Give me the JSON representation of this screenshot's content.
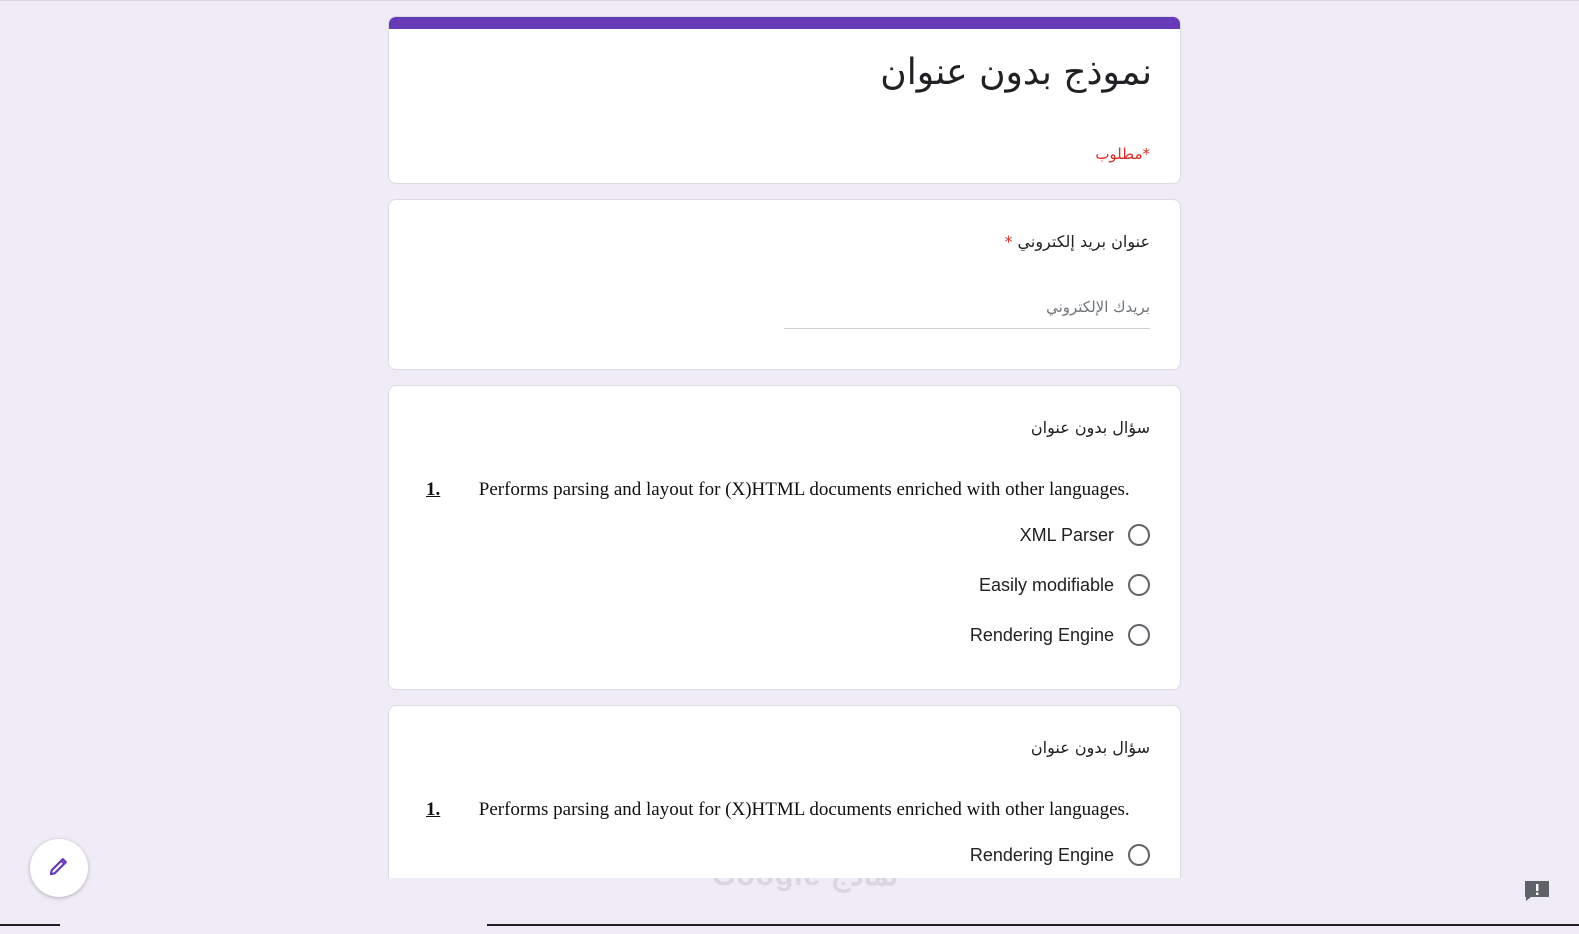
{
  "form": {
    "title": "نموذج بدون عنوان",
    "required_note": "*مطلوب"
  },
  "email": {
    "label": "عنوان بريد إلكتروني",
    "required_mark": "*",
    "placeholder": "بريدك الإلكتروني"
  },
  "questions": [
    {
      "title": "سؤال بدون عنوان",
      "number": "1.",
      "text": "Performs parsing and layout for (X)HTML documents enriched with other languages.",
      "options": [
        "XML Parser",
        "Easily modifiable",
        "Rendering Engine"
      ]
    },
    {
      "title": "سؤال بدون عنوان",
      "number": "1.",
      "text": "Performs parsing and layout for (X)HTML documents enriched with other languages.",
      "options": [
        "Rendering Engine"
      ]
    }
  ],
  "footer": {
    "logo_text": "Google نماذج"
  },
  "icons": {
    "edit": "pencil-icon",
    "report": "report-issue-icon"
  },
  "colors": {
    "accent": "#673ab7",
    "background": "#efebf7",
    "required": "#d93025"
  }
}
